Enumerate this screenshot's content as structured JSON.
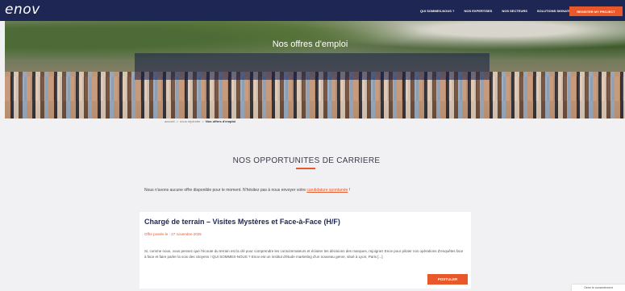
{
  "header": {
    "logo": "enov",
    "menu": [
      "QUI SOMMES-NOUS ?",
      "NOS EXPERTISES",
      "NOS SECTEURS",
      "SOLUTIONS SIGNATURES"
    ],
    "cta": "REGISTER MY PROJECT"
  },
  "hero": {
    "title": "Nos offres d'emploi"
  },
  "breadcrumb": [
    "accueil",
    "nous rejoindre",
    "Nos offres d'emploi"
  ],
  "section": {
    "title": "NOS OPPORTUNITES DE CARRIERE"
  },
  "no_offer": {
    "text": "Nous n'avons aucune offre disponible pour le moment. N'hésitez pas à nous envoyer votre ",
    "link": "candidature spontanée",
    "suffix": " !"
  },
  "job": {
    "title": "Chargé de terrain – Visites Mystères et Face-à-Face (H/F)",
    "date": "Offre postée le : 27 novembre 2025",
    "description": "Si, comme nous, vous pensez que l'écoute du terrain est la clé pour comprendre les consommateurs et éclairer les décisions des marques, rejoignez Enov pour piloter nos opérations d'enquêtes face à face et faire parler la voix des citoyens ! QUI SOMMES-NOUS ? Enov est un institut d'étude marketing d'un nouveau genre, situé à Lyon, Paris [...]",
    "apply": "POSTULER"
  },
  "cookie": {
    "label": "Gérer le consentement"
  },
  "colors": {
    "navy": "#1e2653",
    "accent": "#e8582a",
    "background": "#f1f1f3"
  }
}
